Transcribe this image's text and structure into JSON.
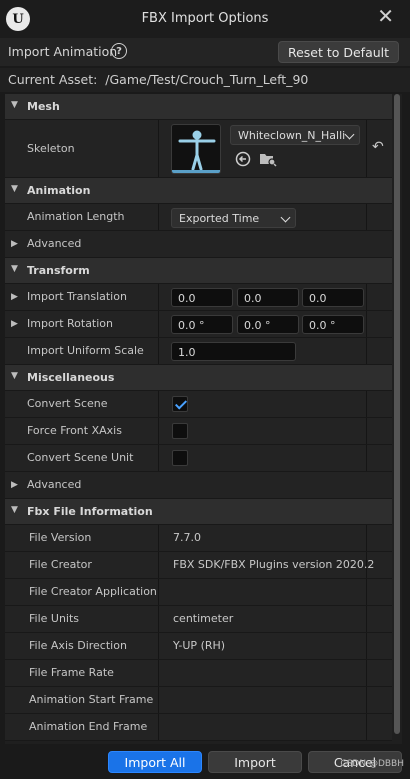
{
  "window": {
    "title": "FBX Import Options"
  },
  "toolbar": {
    "import_animation_label": "Import Animation",
    "reset_label": "Reset to Default"
  },
  "asset": {
    "label": "Current Asset:",
    "path": "/Game/Test/Crouch_Turn_Left_90"
  },
  "mesh": {
    "section": "Mesh",
    "skeleton_label": "Skeleton",
    "skeleton_value": "Whiteclown_N_Halli"
  },
  "animation": {
    "section": "Animation",
    "length_label": "Animation Length",
    "length_value": "Exported Time",
    "advanced_label": "Advanced"
  },
  "transform": {
    "section": "Transform",
    "translation_label": "Import Translation",
    "translation": [
      "0.0",
      "0.0",
      "0.0"
    ],
    "rotation_label": "Import Rotation",
    "rotation": [
      "0.0 °",
      "0.0 °",
      "0.0 °"
    ],
    "scale_label": "Import Uniform Scale",
    "scale_value": "1.0"
  },
  "misc": {
    "section": "Miscellaneous",
    "convert_scene_label": "Convert Scene",
    "convert_scene_checked": true,
    "force_front_label": "Force Front XAxis",
    "force_front_checked": false,
    "convert_unit_label": "Convert Scene Unit",
    "convert_unit_checked": false,
    "advanced_label": "Advanced"
  },
  "fbx": {
    "section": "Fbx File Information",
    "rows": [
      {
        "label": "File Version",
        "value": "7.7.0"
      },
      {
        "label": "File Creator",
        "value": "FBX SDK/FBX Plugins version 2020.2"
      },
      {
        "label": "File Creator Application",
        "value": ""
      },
      {
        "label": "File Units",
        "value": "centimeter"
      },
      {
        "label": "File Axis Direction",
        "value": "Y-UP (RH)"
      },
      {
        "label": "File Frame Rate",
        "value": ""
      },
      {
        "label": "Animation Start Frame",
        "value": ""
      },
      {
        "label": "Animation End Frame",
        "value": ""
      }
    ]
  },
  "footer": {
    "import_all_label": "Import All",
    "import_label": "Import",
    "cancel_label": "Cancel",
    "watermark": "CSDN @DBBH"
  },
  "colors": {
    "accent": "#1a73e8",
    "check": "#4aa2ff",
    "background": "#1a1a1a"
  }
}
